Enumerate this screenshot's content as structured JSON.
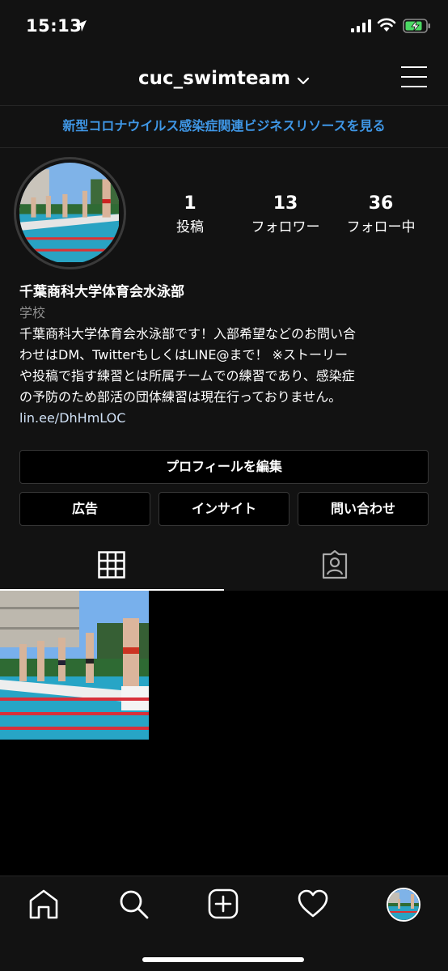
{
  "status": {
    "time": "15:13"
  },
  "header": {
    "username": "cuc_swimteam"
  },
  "banner": {
    "text": "新型コロナウイルス感染症関連ビジネスリソースを見る"
  },
  "stats": [
    {
      "value": "1",
      "label": "投稿"
    },
    {
      "value": "13",
      "label": "フォロワー"
    },
    {
      "value": "36",
      "label": "フォロー中"
    }
  ],
  "bio": {
    "name": "千葉商科大学体育会水泳部",
    "category": "学校",
    "lines": [
      "千葉商科大学体育会水泳部です！入部希望などのお問い合",
      "わせはDM、TwitterもしくはLINE@まで！ ※ストーリー",
      "や投稿で指す練習とは所属チームでの練習であり、感染症",
      "の予防のため部活の団体練習は現在行っておりません。"
    ],
    "link": "lin.ee/DhHmLOC"
  },
  "buttons": {
    "edit_profile": "プロフィールを編集",
    "ads": "広告",
    "insights": "インサイト",
    "contact": "問い合わせ"
  },
  "colors": {
    "link_blue": "#3f97e6",
    "background": "#121212",
    "grid_bg": "#000000"
  },
  "icons": {
    "location": "location-arrow-icon",
    "signal": "signal-icon",
    "wifi": "wifi-icon",
    "battery": "battery-charging-icon",
    "menu": "hamburger-menu-icon",
    "grid": "grid-icon",
    "tagged": "tagged-person-icon",
    "home": "home-icon",
    "search": "search-icon",
    "add": "add-post-icon",
    "activity": "heart-icon"
  }
}
